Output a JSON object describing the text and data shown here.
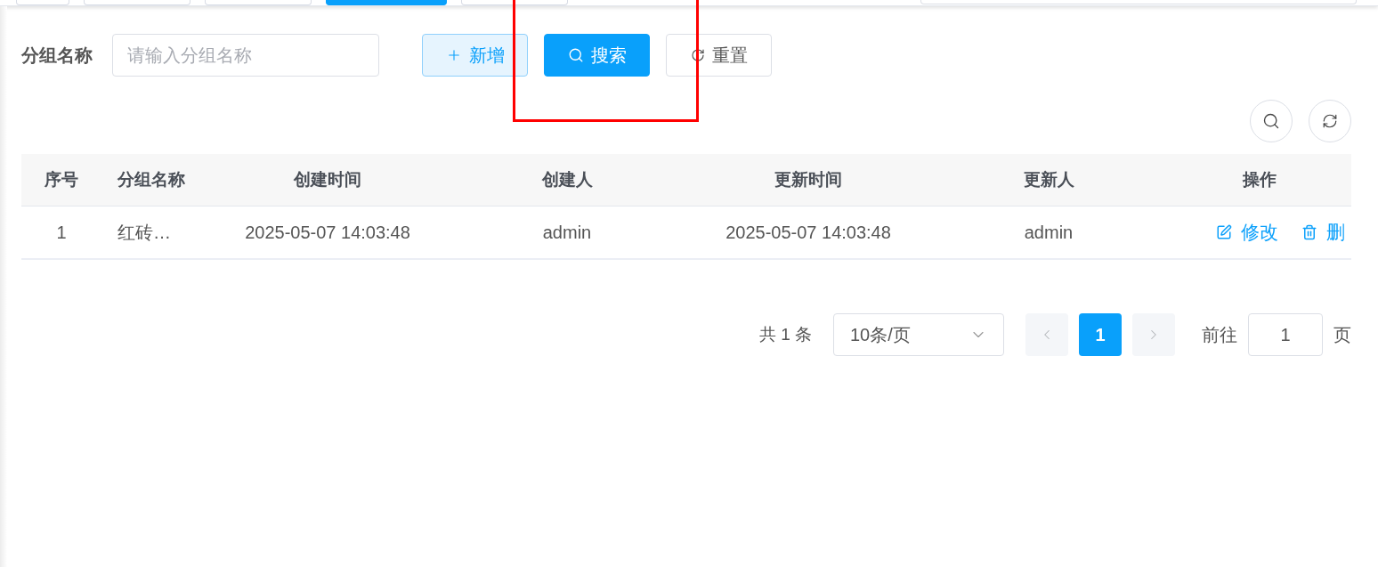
{
  "tags": [
    {
      "selected": false
    },
    {
      "selected": false
    },
    {
      "selected": false
    },
    {
      "selected": true
    },
    {
      "selected": false
    }
  ],
  "filter": {
    "label": "分组名称",
    "placeholder": "请输入分组名称",
    "buttons": [
      {
        "kind": "add",
        "label": "新增"
      },
      {
        "kind": "search",
        "label": "搜索"
      },
      {
        "kind": "reset",
        "label": "重置"
      }
    ]
  },
  "table": {
    "columns": [
      "序号",
      "分组名称",
      "创建时间",
      "创建人",
      "更新时间",
      "更新人",
      "操作"
    ],
    "rows": [
      {
        "cells": [
          "1",
          "红砖…",
          "2025-05-07 14:03:48",
          "admin",
          "2025-05-07 14:03:48",
          "admin"
        ],
        "actions": [
          {
            "kind": "edit",
            "label": "修改"
          },
          {
            "kind": "delete",
            "label": "删"
          }
        ]
      }
    ]
  },
  "pagination": {
    "total": "共 1 条",
    "page_size": "10条/页",
    "pages": [
      {
        "label": "1",
        "selected": true
      }
    ],
    "goto_label": "前往",
    "goto_value": "1",
    "goto_suffix": "页"
  }
}
